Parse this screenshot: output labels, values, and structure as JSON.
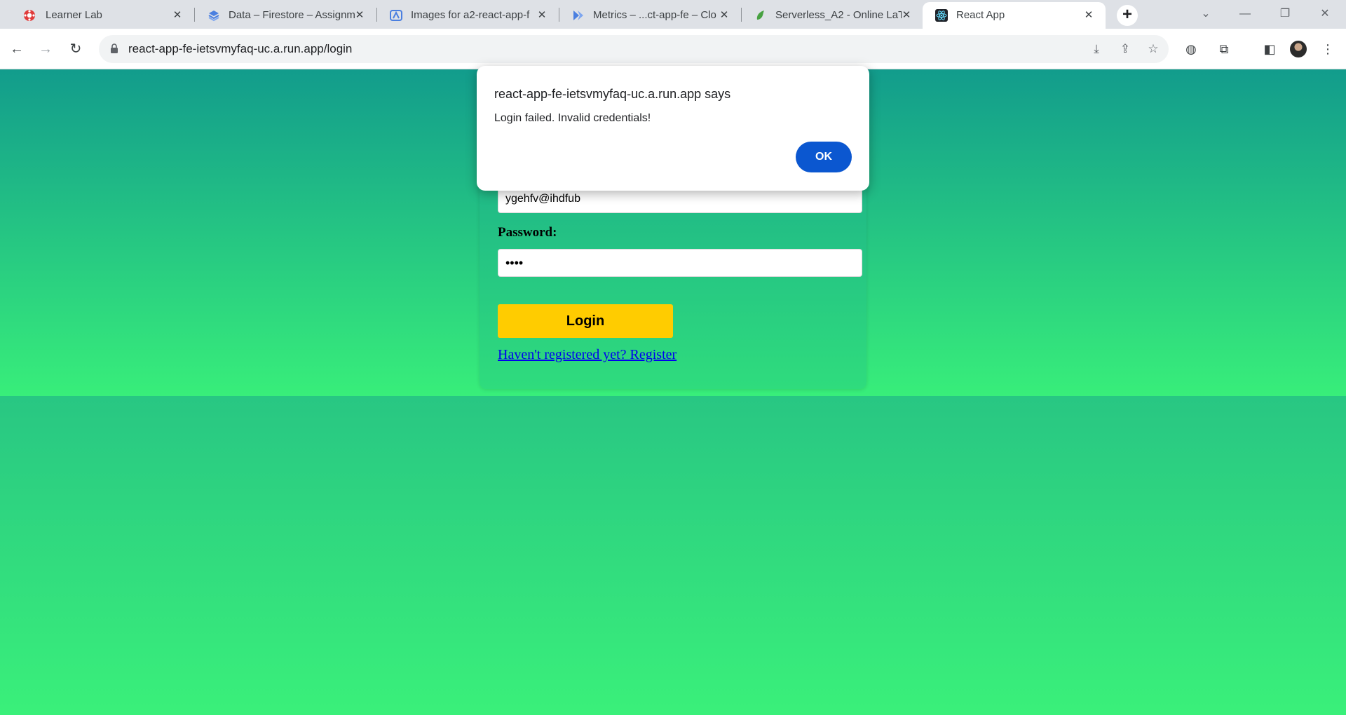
{
  "browser": {
    "tabs": [
      {
        "title": "Learner Lab",
        "icon": "learner-lab-icon",
        "active": false
      },
      {
        "title": "Data – Firestore – Assignm",
        "icon": "firestore-icon",
        "active": false
      },
      {
        "title": "Images for a2-react-app-f",
        "icon": "artifact-registry-icon",
        "active": false
      },
      {
        "title": "Metrics – ...ct-app-fe – Clo",
        "icon": "cloud-run-icon",
        "active": false
      },
      {
        "title": "Serverless_A2 - Online LaT",
        "icon": "overleaf-icon",
        "active": false
      },
      {
        "title": "React App",
        "icon": "react-icon",
        "active": true
      }
    ],
    "url": "react-app-fe-ietsvmyfaq-uc.a.run.app/login",
    "colors": {
      "tabstrip": "#dee1e6",
      "active_tab": "#ffffff",
      "omnibox": "#f1f3f4"
    }
  },
  "login_form": {
    "email_value": "ygehfv@ihdfub",
    "password_label": "Password:",
    "password_value": "••••",
    "login_button": "Login",
    "register_link": "Haven't registered yet? Register",
    "colors": {
      "button": "#ffcc00",
      "link": "#0000ee",
      "gradient_top": "#129c8c",
      "gradient_bottom": "#38ee7a"
    }
  },
  "alert_dialog": {
    "title": "react-app-fe-ietsvmyfaq-uc.a.run.app says",
    "message": "Login failed. Invalid credentials!",
    "ok_button": "OK",
    "colors": {
      "ok_button": "#0b57d0"
    }
  }
}
